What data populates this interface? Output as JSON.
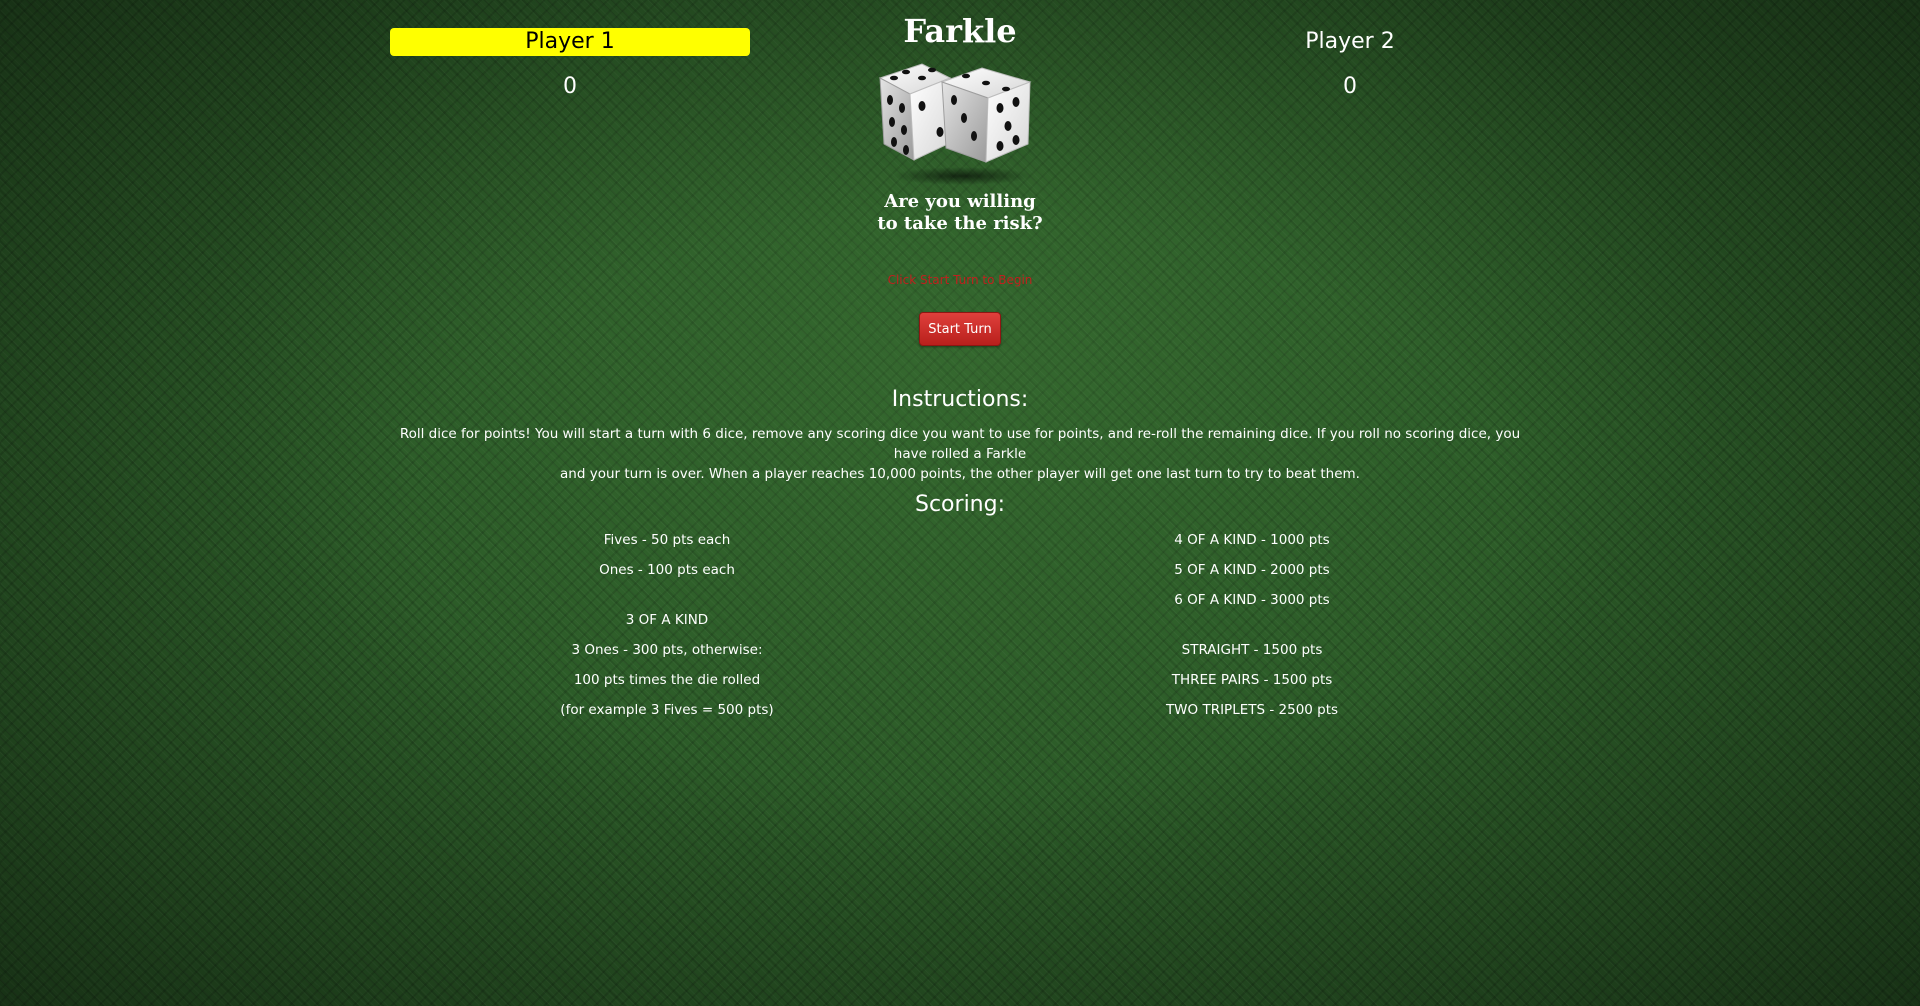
{
  "game": {
    "title": "Farkle",
    "tagline_line1": "Are you willing",
    "tagline_line2": "to take the risk?",
    "hint": "Click Start Turn to Begin",
    "start_button": "Start Turn"
  },
  "players": [
    {
      "name": "Player 1",
      "score": "0",
      "active": true
    },
    {
      "name": "Player 2",
      "score": "0",
      "active": false
    }
  ],
  "instructions": {
    "title": "Instructions:",
    "line1": "Roll dice for points! You will start a turn with 6 dice, remove any scoring dice you want to use for points, and re-roll the remaining dice. If you roll no scoring dice, you have rolled a Farkle",
    "line2": "and your turn is over. When a player reaches 10,000 points, the other player will get one last turn to try to beat them."
  },
  "scoring": {
    "title": "Scoring:",
    "left": {
      "fives": "Fives - 50 pts each",
      "ones": "Ones - 100 pts each",
      "three_kind_heading": "3 OF A KIND",
      "three_ones": "3 Ones - 300 pts, otherwise:",
      "times_die": "100 pts times the die rolled",
      "example": "(for example 3 Fives = 500 pts)"
    },
    "right": {
      "four_kind": "4 OF A KIND - 1000 pts",
      "five_kind": "5 OF A KIND - 2000 pts",
      "six_kind": "6 OF A KIND - 3000 pts",
      "straight": "STRAIGHT - 1500 pts",
      "three_pairs": "THREE PAIRS - 1500 pts",
      "two_triplets": "TWO TRIPLETS - 2500 pts"
    }
  },
  "colors": {
    "background": "#2b5a27",
    "active_player_highlight": "#ffff00",
    "hint_text": "#c0201e",
    "button": "#d0302c"
  },
  "icons": {
    "logo": "dice-pair-icon"
  }
}
